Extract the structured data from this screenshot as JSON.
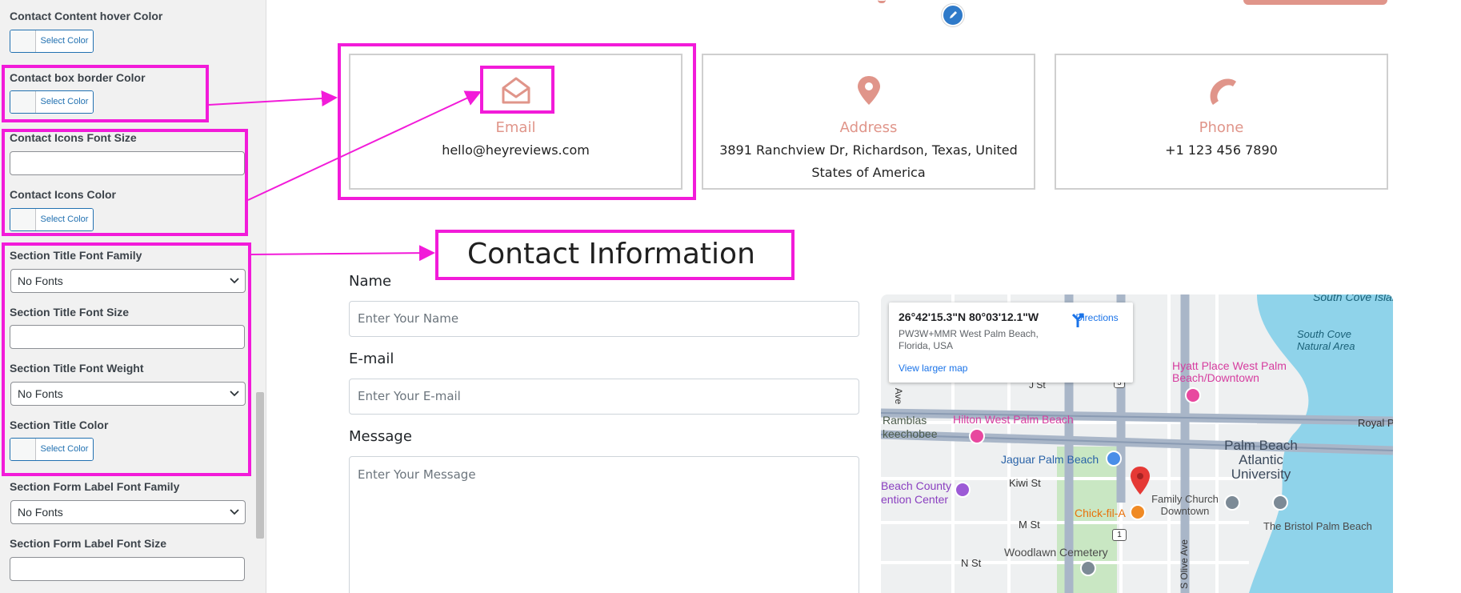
{
  "panel": {
    "contact_hover_label": "Contact Content hover Color",
    "box_border_label": "Contact box border Color",
    "icons_font_size_label": "Contact Icons Font Size",
    "icons_color_label": "Contact Icons Color",
    "title_font_family_label": "Section Title Font Family",
    "title_font_size_label": "Section Title Font Size",
    "title_font_weight_label": "Section Title Font Weight",
    "title_color_label": "Section Title Color",
    "form_label_font_family_label": "Section Form Label Font Family",
    "form_label_font_size_label": "Section Form Label Font Size",
    "select_color_text": "Select Color",
    "no_fonts_option": "No Fonts"
  },
  "cards": [
    {
      "icon": "envelope-open-icon",
      "title": "Email",
      "value": "hello@heyreviews.com"
    },
    {
      "icon": "map-pin-icon",
      "title": "Address",
      "value": "3891 Ranchview Dr, Richardson, Texas, United States of America"
    },
    {
      "icon": "phone-icon",
      "title": "Phone",
      "value": "+1 123 456 7890"
    }
  ],
  "section_title": "Contact Information",
  "form": {
    "name_label": "Name",
    "name_placeholder": "Enter Your Name",
    "email_label": "E-mail",
    "email_placeholder": "Enter Your E-mail",
    "message_label": "Message",
    "message_placeholder": "Enter Your Message"
  },
  "map": {
    "coords": "26°42'15.3\"N 80°03'12.1\"W",
    "address": "PW3W+MMR West Palm Beach, Florida, USA",
    "directions": "Directions",
    "larger_map": "View larger map",
    "labels": {
      "south_cove_islands": "South Cove Islands",
      "south_cove_natural": "South Cove Natural Area",
      "hyatt": "Hyatt Place West Palm Beach/Downtown",
      "hilton": "Hilton West Palm Beach",
      "ramblas": "Ramblas",
      "okeechobee": "keechobee",
      "jaguar": "Jaguar Palm Beach",
      "palm_beach_atlantic": "Palm Beach Atlantic University",
      "royal": "Royal P",
      "kiwi": "Kiwi St",
      "county": "Beach County",
      "convention": "ention Center",
      "chick": "Chick-fil-A",
      "family_church": "Family Church Downtown",
      "bristol": "The Bristol Palm Beach",
      "m_st": "M St",
      "woodlawn": "Woodlawn Cemetery",
      "n_st": "N St",
      "j_st": "J St",
      "ave": "Ave",
      "olive": "S Olive Ave",
      "route": "1",
      "route2": "5"
    }
  },
  "colors": {
    "accent": "#e0958a",
    "highlight": "#f21bd9",
    "panel_bg": "#f1f1f1",
    "wp_blue": "#2271b1"
  }
}
